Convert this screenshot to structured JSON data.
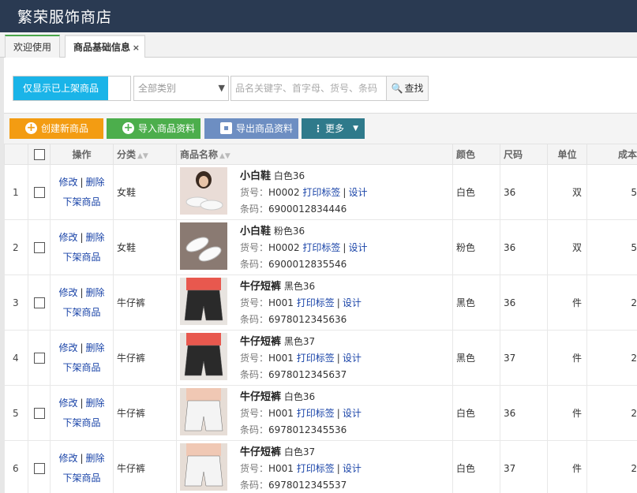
{
  "app": {
    "title": "繁荣服饰商店"
  },
  "tabs": [
    {
      "label": "欢迎使用"
    },
    {
      "label": "商品基础信息",
      "close": "×"
    }
  ],
  "search": {
    "shelf_only_label": "仅显示已上架商品",
    "category_value": "全部类别",
    "keyword_placeholder": "品名关键字、首字母、货号、条码",
    "find_label": "查找"
  },
  "toolbar": {
    "create_label": "创建新商品",
    "import_label": "导入商品资料",
    "export_label": "导出商品资料",
    "more_label": "更多"
  },
  "table": {
    "headers": {
      "ops": "操作",
      "category": "分类",
      "name": "商品名称",
      "color": "颜色",
      "size": "尺码",
      "unit": "单位",
      "cost": "成本"
    },
    "labels": {
      "edit": "修改",
      "delete": "删除",
      "unshelf": "下架商品",
      "sku_prefix": "货号：",
      "barcode_prefix": "条码：",
      "print_label": "打印标签",
      "design": "设计"
    },
    "rows": [
      {
        "num": "1",
        "category": "女鞋",
        "name": "小白鞋",
        "variant": "白色36",
        "sku": "H0002",
        "barcode": "6900012834446",
        "color": "白色",
        "size": "36",
        "unit": "双",
        "cost": "5"
      },
      {
        "num": "2",
        "category": "女鞋",
        "name": "小白鞋",
        "variant": "粉色36",
        "sku": "H0002",
        "barcode": "6900012835546",
        "color": "粉色",
        "size": "36",
        "unit": "双",
        "cost": "5"
      },
      {
        "num": "3",
        "category": "牛仔裤",
        "name": "牛仔短裤",
        "variant": "黑色36",
        "sku": "H001",
        "barcode": "6978012345636",
        "color": "黑色",
        "size": "36",
        "unit": "件",
        "cost": "2"
      },
      {
        "num": "4",
        "category": "牛仔裤",
        "name": "牛仔短裤",
        "variant": "黑色37",
        "sku": "H001",
        "barcode": "6978012345637",
        "color": "黑色",
        "size": "37",
        "unit": "件",
        "cost": "2"
      },
      {
        "num": "5",
        "category": "牛仔裤",
        "name": "牛仔短裤",
        "variant": "白色36",
        "sku": "H001",
        "barcode": "6978012345536",
        "color": "白色",
        "size": "36",
        "unit": "件",
        "cost": "2"
      },
      {
        "num": "6",
        "category": "牛仔裤",
        "name": "牛仔短裤",
        "variant": "白色37",
        "sku": "H001",
        "barcode": "6978012345537",
        "color": "白色",
        "size": "37",
        "unit": "件",
        "cost": "2"
      }
    ]
  }
}
